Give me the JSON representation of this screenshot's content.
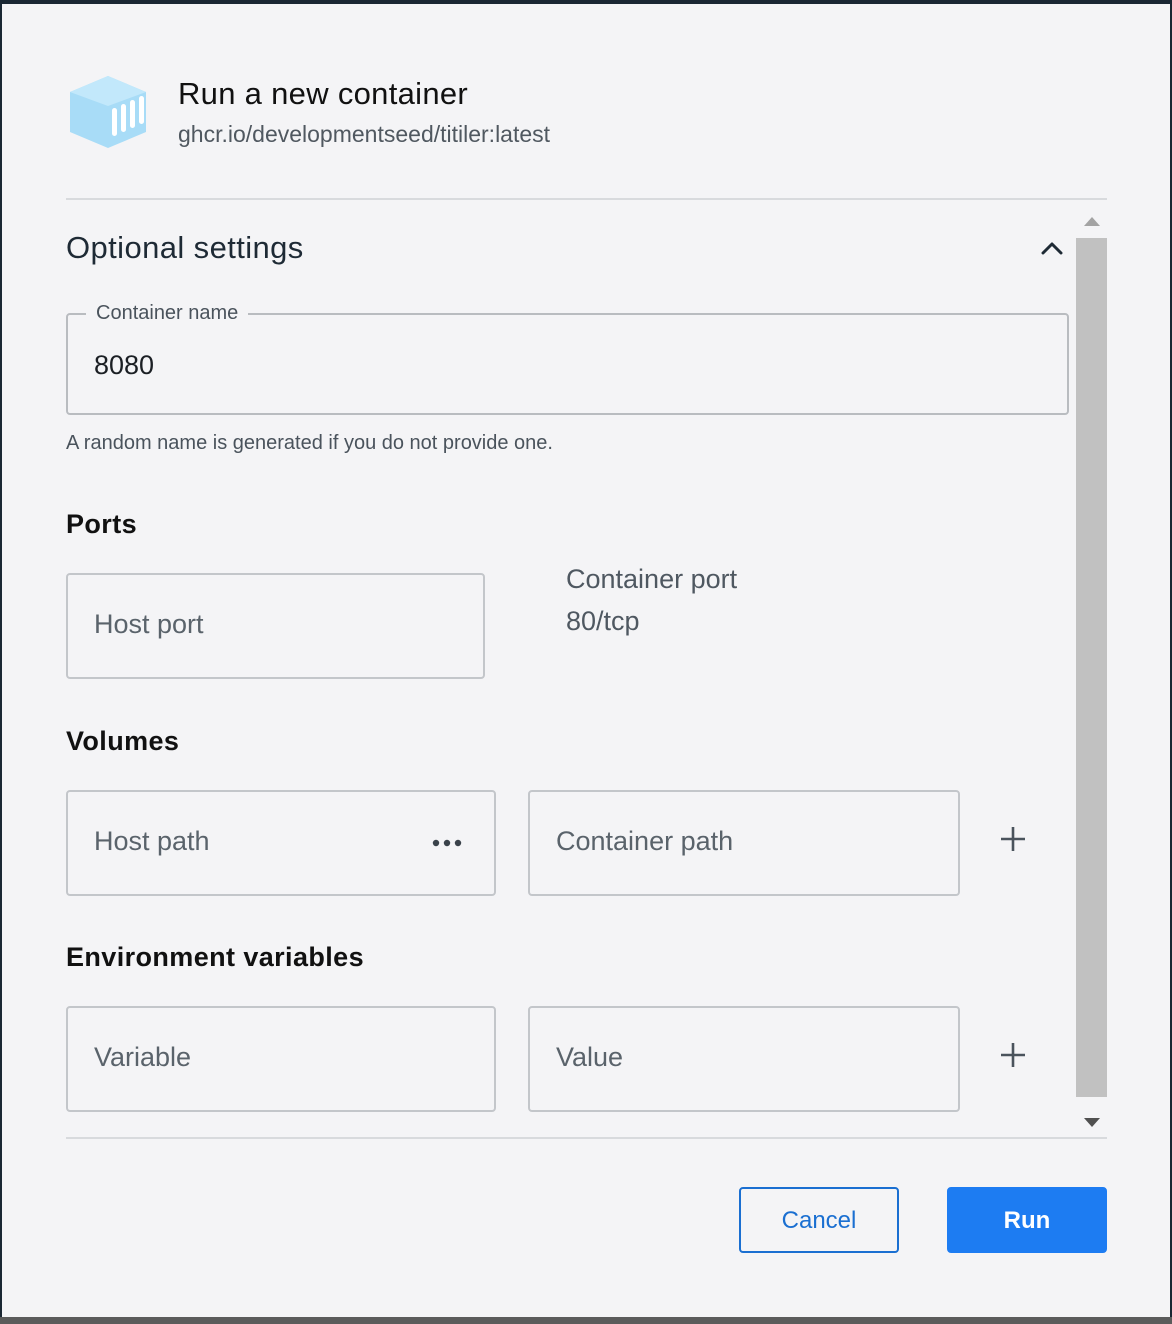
{
  "header": {
    "title": "Run a new container",
    "image_name": "ghcr.io/developmentseed/titiler:latest",
    "icon": "container-icon"
  },
  "optional_settings": {
    "title": "Optional settings",
    "expanded": true,
    "container_name": {
      "label": "Container name",
      "value": "8080",
      "helper": "A random name is generated if you do not provide one."
    },
    "ports": {
      "heading": "Ports",
      "host_port_placeholder": "Host port",
      "container_port_label": "Container port",
      "container_port_value": "80/tcp"
    },
    "volumes": {
      "heading": "Volumes",
      "host_path_placeholder": "Host path",
      "container_path_placeholder": "Container path"
    },
    "environment": {
      "heading": "Environment variables",
      "variable_placeholder": "Variable",
      "value_placeholder": "Value"
    }
  },
  "footer": {
    "cancel_label": "Cancel",
    "run_label": "Run"
  },
  "colors": {
    "accent": "#1d7cf2",
    "icon": "#a8dcf7",
    "background": "#f4f4f6"
  }
}
